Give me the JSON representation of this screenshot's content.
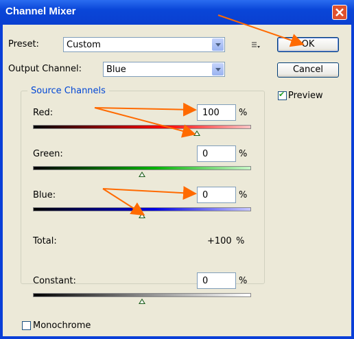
{
  "window": {
    "title": "Channel Mixer"
  },
  "preset": {
    "label": "Preset:",
    "value": "Custom"
  },
  "output_channel": {
    "label": "Output Channel:",
    "value": "Blue"
  },
  "buttons": {
    "ok": "OK",
    "cancel": "Cancel"
  },
  "preview": {
    "label": "Preview",
    "checked": true
  },
  "source_channels": {
    "title": "Source Channels",
    "red": {
      "label": "Red:",
      "value": "100",
      "unit": "%",
      "slider_level": 0.75
    },
    "green": {
      "label": "Green:",
      "value": "0",
      "unit": "%",
      "slider_level": 0.5
    },
    "blue": {
      "label": "Blue:",
      "value": "0",
      "unit": "%",
      "slider_level": 0.5
    },
    "total": {
      "label": "Total:",
      "value": "+100",
      "unit": "%"
    }
  },
  "constant": {
    "label": "Constant:",
    "value": "0",
    "unit": "%",
    "slider_level": 0.5
  },
  "monochrome": {
    "label": "Monochrome",
    "checked": false
  },
  "colors": {
    "annotation_arrow": "#ff6a00",
    "group_title": "#0046d5"
  }
}
